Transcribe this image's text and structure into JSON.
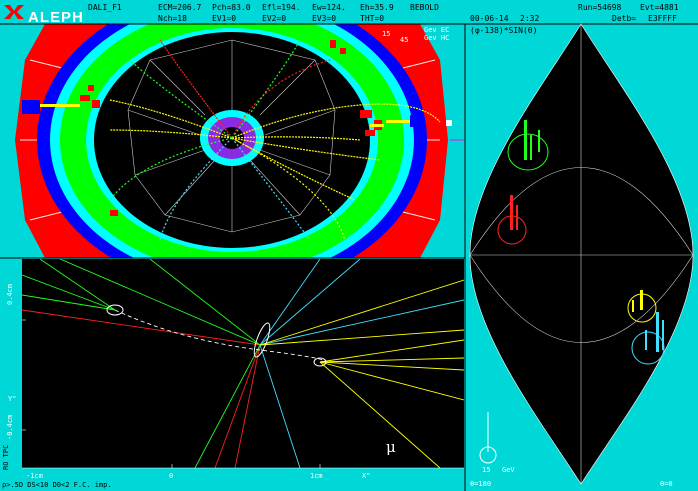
{
  "header": {
    "program": "DALI_F1",
    "line1": {
      "ecm": "ECM=206.7",
      "pch": "Pch=83.0",
      "efl": "Efl=194.",
      "ew": "Ew=124.",
      "eh": "Eh=35.9",
      "user": "BEBOLD",
      "run": "Run=54698",
      "evt": "Evt=4881"
    },
    "line2": {
      "nch": "Nch=18",
      "ev1": "EV1=0",
      "ev2": "EV2=0",
      "ev3": "EV3=0",
      "theta": "THT=0",
      "date": "00-06-14",
      "time": "2:32",
      "detb": "Detb=",
      "detb_code": "E3FFFF"
    }
  },
  "logo": {
    "text": "ALEPH",
    "color": "#ff0000"
  },
  "top_left_view": {
    "scale_top": "15",
    "scale_unit_1": "Gev EC",
    "scale_unit_2": "Gev HC",
    "scale_bottom": "45"
  },
  "right_view": {
    "title": "(φ-138)*SIN(θ)",
    "scale_value": "15",
    "scale_unit": "GeV",
    "bottom_left": "θ=180",
    "bottom_right": "θ=0"
  },
  "bottom_view": {
    "y_label_top": "0.4cm",
    "y_label_bottom": "-0.4cm",
    "y_axis_name": "Y\"",
    "x_label_left": "-1cm",
    "x_label_mid": "0",
    "x_label_right": "1cm",
    "x_axis_name": "X\"",
    "side_text": "RO TPC",
    "mu_symbol": "μ",
    "footer": "ρ>.5D DS<10 D0<2 F.C. imp."
  },
  "colors": {
    "background": "#00d8d8",
    "ecal": "#00ff00",
    "hcal": "#ff0000",
    "coil": "#0000ff",
    "tracks_yellow": "#ffff00",
    "tracks_red": "#ff2020",
    "tracks_green": "#20ff20",
    "tracks_cyan": "#40e0ff",
    "vdet": "#8a2be2"
  }
}
